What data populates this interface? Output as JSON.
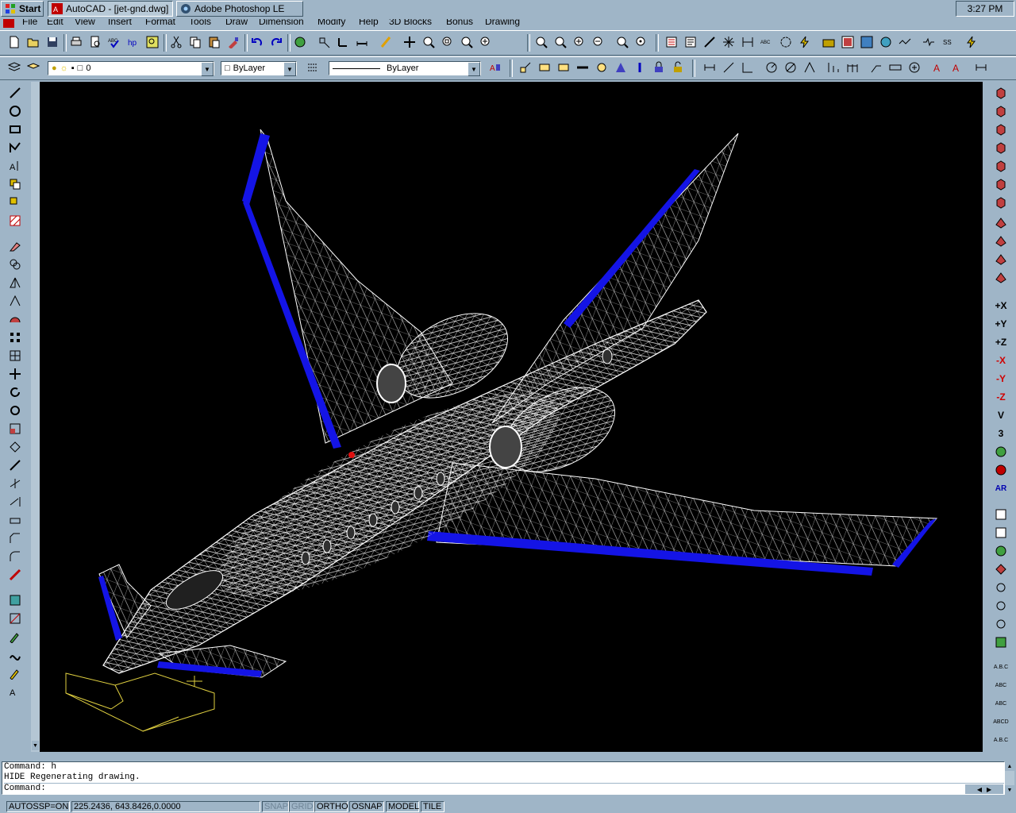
{
  "taskbar": {
    "start_label": "Start",
    "tasks": [
      {
        "label": "AutoCAD - [jet-gnd.dwg]",
        "icon": "autocad-app-icon"
      },
      {
        "label": "Adobe Photoshop LE",
        "icon": "photoshop-app-icon"
      }
    ],
    "clock": "3:27 PM"
  },
  "menu": [
    "File",
    "Edit",
    "View",
    "Insert",
    "Format",
    "Tools",
    "Draw",
    "Dimension",
    "Modify",
    "Help",
    "3D Blocks",
    "Bonus",
    "Drawing"
  ],
  "layer_toolbar": {
    "layer_value": "0",
    "color_value": "ByLayer",
    "linetype_value": "ByLayer"
  },
  "right_toolbar_labels": [
    "+X",
    "+Y",
    "+Z",
    "-X",
    "-Y",
    "-Z",
    "V",
    "3",
    "AR"
  ],
  "command": {
    "lines": [
      "Command: h",
      "HIDE Regenerating drawing."
    ],
    "prompt": "Command:"
  },
  "status": {
    "autosnap": "AUTOSSP=ON",
    "coords": "225.2436, 643.8426,0.0000",
    "snap": "SNAP",
    "grid": "GRID",
    "ortho": "ORTHO",
    "osnap": "OSNAP",
    "model": "MODEL",
    "tile": "TILE"
  },
  "colors": {
    "canvas": "#000000",
    "wire": "#ffffff",
    "edge": "#1010e8",
    "ui": "#9fb5c7"
  }
}
